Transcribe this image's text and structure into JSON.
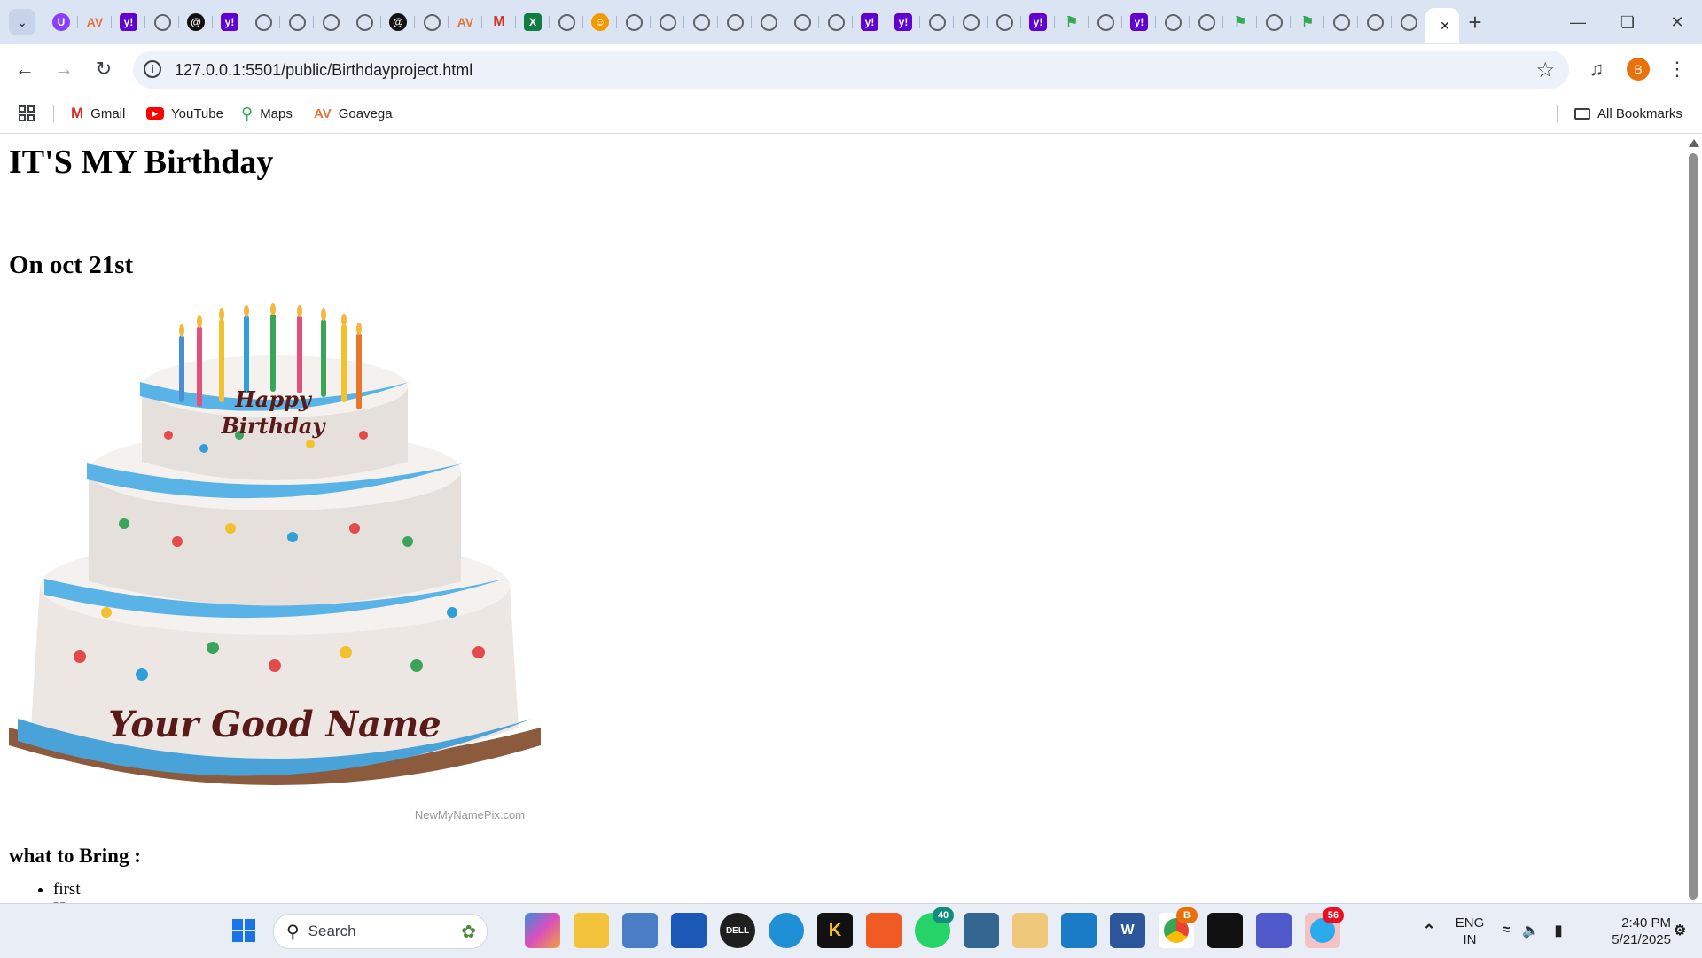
{
  "browser": {
    "tabs": [
      {
        "icon": "u-icon"
      },
      {
        "icon": "av-icon"
      },
      {
        "icon": "yahoo-icon"
      },
      {
        "icon": "globe-icon"
      },
      {
        "icon": "threads-icon"
      },
      {
        "icon": "yahoo-icon"
      },
      {
        "icon": "globe-icon"
      },
      {
        "icon": "globe-icon"
      },
      {
        "icon": "globe-icon"
      },
      {
        "icon": "globe-icon"
      },
      {
        "icon": "threads-icon"
      },
      {
        "icon": "globe-icon"
      },
      {
        "icon": "av-icon"
      },
      {
        "icon": "gmail-icon"
      },
      {
        "icon": "excel-icon"
      },
      {
        "icon": "globe-icon"
      },
      {
        "icon": "hp-icon"
      },
      {
        "icon": "globe-icon"
      },
      {
        "icon": "globe-icon"
      },
      {
        "icon": "globe-icon"
      },
      {
        "icon": "globe-icon"
      },
      {
        "icon": "globe-icon"
      },
      {
        "icon": "globe-icon"
      },
      {
        "icon": "globe-icon"
      },
      {
        "icon": "yahoo-icon"
      },
      {
        "icon": "yahoo-icon"
      },
      {
        "icon": "globe-icon"
      },
      {
        "icon": "globe-icon"
      },
      {
        "icon": "globe-icon"
      },
      {
        "icon": "yahoo-icon"
      },
      {
        "icon": "maps-icon"
      },
      {
        "icon": "globe-icon"
      },
      {
        "icon": "yahoo-icon"
      },
      {
        "icon": "globe-icon"
      },
      {
        "icon": "globe-icon"
      },
      {
        "icon": "maps-icon"
      },
      {
        "icon": "globe-icon"
      },
      {
        "icon": "maps-icon"
      },
      {
        "icon": "globe-icon"
      },
      {
        "icon": "globe-icon"
      },
      {
        "icon": "globe-icon"
      },
      {
        "icon": "globe-icon",
        "active": true
      }
    ],
    "url": "127.0.0.1:5501/public/Birthdayproject.html",
    "profile_initial": "B",
    "bookmarks": {
      "gmail": "Gmail",
      "youtube": "YouTube",
      "maps": "Maps",
      "goavega": "Goavega",
      "all": "All Bookmarks"
    },
    "accent": "#dbe4f3"
  },
  "page": {
    "title": "IT'S MY Birthday",
    "subtitle": "On oct 21st",
    "cake_top_text_1": "Happy",
    "cake_top_text_2": "Birthday",
    "cake_name_text": "Your Good Name",
    "cake_watermark": "NewMyNamePix.com",
    "what_to_bring_heading": "what to Bring :",
    "list_items": [
      "first Happy for Coming all"
    ]
  },
  "taskbar": {
    "search_placeholder": "Search",
    "whatsapp_badge": "40",
    "chrome_badge": "B",
    "telegram_badge": "56",
    "language": "ENG",
    "region": "IN",
    "time": "2:40 PM",
    "date": "5/21/2025"
  }
}
